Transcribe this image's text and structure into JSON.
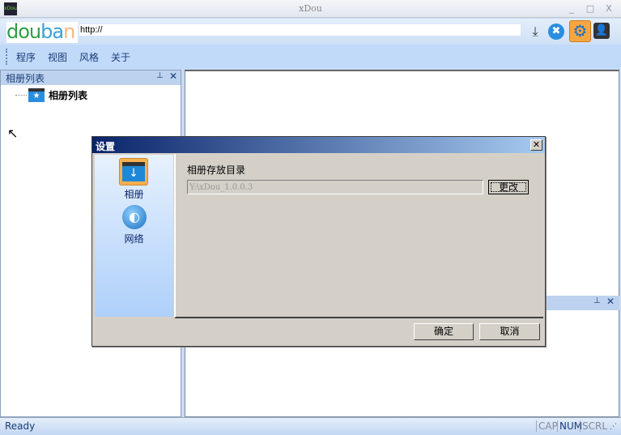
{
  "window": {
    "title": "xDou",
    "app_icon_text": "xDou"
  },
  "toolbar": {
    "logo": "douban",
    "url": "http://",
    "icons": [
      "download-icon",
      "stop-icon",
      "settings-icon",
      "user-icon"
    ]
  },
  "menu": [
    "程序",
    "视图",
    "风格",
    "关于"
  ],
  "left_pane": {
    "title": "相册列表",
    "tree": [
      {
        "label": "相册列表",
        "icon": "album-folder-icon"
      }
    ]
  },
  "status": {
    "text": "Ready",
    "indicators": [
      "CAP",
      "NUM",
      "SCRL"
    ]
  },
  "dialog": {
    "title": "设置",
    "sidebar": [
      {
        "label": "相册",
        "icon": "album-download-icon",
        "selected": true
      },
      {
        "label": "网络",
        "icon": "globe-icon"
      }
    ],
    "field_label": "相册存放目录",
    "path_value": "Y:\\xDou_1.0.0.3",
    "change_button": "更改",
    "ok": "确定",
    "cancel": "取消"
  }
}
